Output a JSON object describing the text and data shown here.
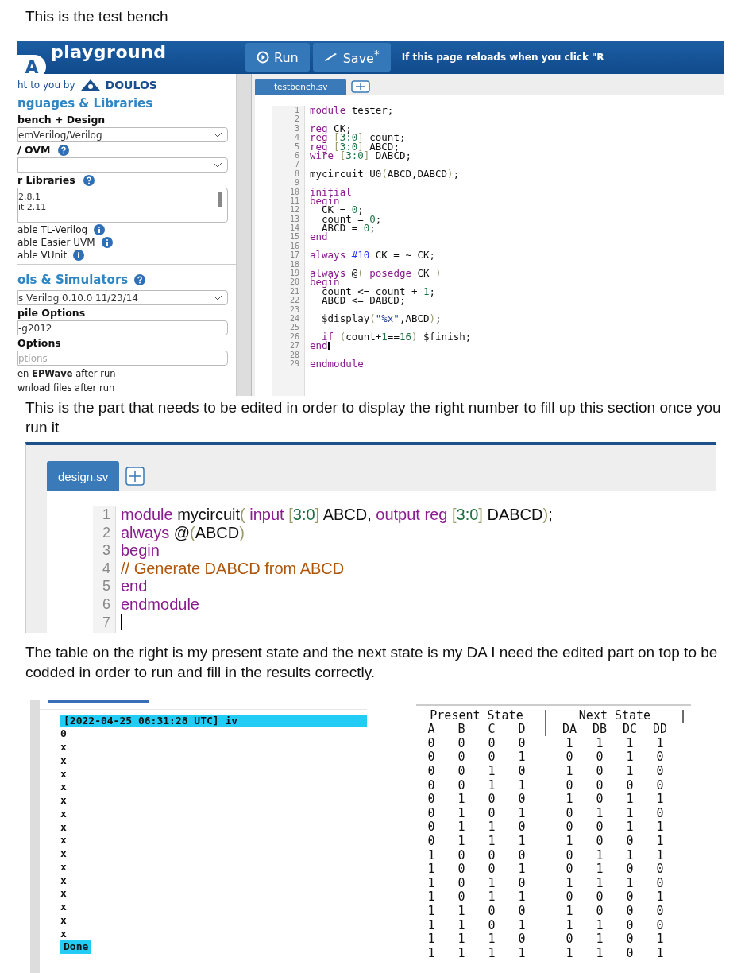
{
  "captions": [
    "This is the test bench",
    "This is the part that needs to be edited in order to display the right number to fill up this section once you run it",
    "The table on the right is my present state and the next state is my DA I need the edited part on top to be codded in order to run and fill in the results correctly."
  ],
  "playground": {
    "logo_letter": "A",
    "logo": "playground",
    "buttons": [
      {
        "kind": "run",
        "label": "Run"
      },
      {
        "kind": "save",
        "label": "Save$^{*}$"
      }
    ],
    "notice": "If this page reloads when you click \"R",
    "sidebar": [
      {
        "kind": "credit",
        "text": "ht to you by",
        "logo": "DOULOS"
      },
      {
        "kind": "heading",
        "text": "nguages & Libraries",
        "help": false
      },
      {
        "kind": "label",
        "text": "bench + Design",
        "help": false
      },
      {
        "kind": "select",
        "value": "emVerilog/Verilog"
      },
      {
        "kind": "label",
        "text": "/ OVM",
        "help": true
      },
      {
        "kind": "select"
      },
      {
        "kind": "label",
        "text": "r Libraries",
        "help": true
      },
      {
        "kind": "listbox",
        "options": [
          "2.8.1",
          "it 2.11"
        ]
      },
      {
        "kind": "option",
        "text": "able TL-Verilog"
      },
      {
        "kind": "option",
        "text": "able Easier UVM"
      },
      {
        "kind": "option",
        "text": "able VUnit"
      },
      {
        "kind": "heading",
        "text": "ols & Simulators",
        "help": true
      },
      {
        "kind": "select",
        "value": "s Verilog 0.10.0 11/23/14"
      },
      {
        "kind": "label",
        "text": "pile Options",
        "help": false
      },
      {
        "kind": "field",
        "value": "-g2012"
      },
      {
        "kind": "label",
        "text": "Options",
        "help": false
      },
      {
        "kind": "field",
        "placeholder": "ptions"
      },
      {
        "kind": "note",
        "text": "en **EPWave** after run"
      },
      {
        "kind": "note",
        "text": "wnload files after run"
      }
    ],
    "tab": "testbench.sv",
    "code": [
      {
        "number": "1",
        "tokens": [
          {
            "kind": "keyword",
            "text": "module"
          },
          {
            "kind": "plain",
            "text": " tester;"
          }
        ]
      },
      {
        "number": "2"
      },
      {
        "number": "3",
        "tokens": [
          {
            "kind": "keyword",
            "text": "reg"
          },
          {
            "kind": "plain",
            "text": " CK;"
          }
        ]
      },
      {
        "number": "4",
        "tokens": [
          {
            "kind": "keyword",
            "text": "reg"
          },
          {
            "kind": "bracket",
            "text": " ["
          },
          {
            "kind": "number",
            "text": "3:0"
          },
          {
            "kind": "bracket",
            "text": "]"
          },
          {
            "kind": "plain",
            "text": " count;"
          }
        ]
      },
      {
        "number": "5",
        "tokens": [
          {
            "kind": "keyword",
            "text": "reg"
          },
          {
            "kind": "bracket",
            "text": " ["
          },
          {
            "kind": "number",
            "text": "3:0"
          },
          {
            "kind": "bracket",
            "text": "]"
          },
          {
            "kind": "plain",
            "text": " ABCD;"
          }
        ]
      },
      {
        "number": "6",
        "tokens": [
          {
            "kind": "keyword",
            "text": "wire"
          },
          {
            "kind": "bracket",
            "text": " ["
          },
          {
            "kind": "number",
            "text": "3:0"
          },
          {
            "kind": "bracket",
            "text": "]"
          },
          {
            "kind": "plain",
            "text": " DABCD;"
          }
        ]
      },
      {
        "number": "7"
      },
      {
        "number": "8",
        "tokens": [
          {
            "kind": "plain",
            "text": "mycircuit U0"
          },
          {
            "kind": "bracket",
            "text": "("
          },
          {
            "kind": "plain",
            "text": "ABCD,DABCD"
          },
          {
            "kind": "bracket",
            "text": ")"
          },
          {
            "kind": "plain",
            "text": ";"
          }
        ]
      },
      {
        "number": "9"
      },
      {
        "number": "10",
        "tokens": [
          {
            "kind": "keyword",
            "text": "initial"
          }
        ]
      },
      {
        "number": "11",
        "tokens": [
          {
            "kind": "keyword",
            "text": "begin"
          }
        ]
      },
      {
        "number": "12",
        "tokens": [
          {
            "kind": "plain",
            "text": "  CK = "
          },
          {
            "kind": "number",
            "text": "0"
          },
          {
            "kind": "plain",
            "text": ";"
          }
        ]
      },
      {
        "number": "13",
        "tokens": [
          {
            "kind": "plain",
            "text": "  count = "
          },
          {
            "kind": "number",
            "text": "0"
          },
          {
            "kind": "plain",
            "text": ";"
          }
        ]
      },
      {
        "number": "14",
        "tokens": [
          {
            "kind": "plain",
            "text": "  ABCD = "
          },
          {
            "kind": "number",
            "text": "0"
          },
          {
            "kind": "plain",
            "text": ";"
          }
        ]
      },
      {
        "number": "15",
        "tokens": [
          {
            "kind": "keyword",
            "text": "end"
          }
        ]
      },
      {
        "number": "16"
      },
      {
        "number": "17",
        "tokens": [
          {
            "kind": "keyword",
            "text": "always"
          },
          {
            "kind": "delay",
            "text": " #10"
          },
          {
            "kind": "plain",
            "text": " CK = ~ CK;"
          }
        ]
      },
      {
        "number": "18"
      },
      {
        "number": "19",
        "tokens": [
          {
            "kind": "keyword",
            "text": "always"
          },
          {
            "kind": "plain",
            "text": " @"
          },
          {
            "kind": "bracket",
            "text": "("
          },
          {
            "kind": "keyword",
            "text": " posedge"
          },
          {
            "kind": "plain",
            "text": " CK "
          },
          {
            "kind": "bracket",
            "text": ")"
          }
        ]
      },
      {
        "number": "20",
        "tokens": [
          {
            "kind": "keyword",
            "text": "begin"
          }
        ]
      },
      {
        "number": "21",
        "tokens": [
          {
            "kind": "plain",
            "text": "  count <= count + "
          },
          {
            "kind": "number",
            "text": "1"
          },
          {
            "kind": "plain",
            "text": ";"
          }
        ]
      },
      {
        "number": "22",
        "tokens": [
          {
            "kind": "plain",
            "text": "  ABCD <= DABCD;"
          }
        ]
      },
      {
        "number": "23"
      },
      {
        "number": "24",
        "tokens": [
          {
            "kind": "plain",
            "text": "  $display"
          },
          {
            "kind": "bracket",
            "text": "("
          },
          {
            "kind": "string",
            "text": "\"%x\""
          },
          {
            "kind": "plain",
            "text": ",ABCD"
          },
          {
            "kind": "bracket",
            "text": ")"
          },
          {
            "kind": "plain",
            "text": ";"
          }
        ]
      },
      {
        "number": "25"
      },
      {
        "number": "26",
        "tokens": [
          {
            "kind": "keyword",
            "text": "  if"
          },
          {
            "kind": "bracket",
            "text": " ("
          },
          {
            "kind": "plain",
            "text": "count+"
          },
          {
            "kind": "number",
            "text": "1"
          },
          {
            "kind": "plain",
            "text": "=="
          },
          {
            "kind": "number",
            "text": "16"
          },
          {
            "kind": "bracket",
            "text": ")"
          },
          {
            "kind": "plain",
            "text": " $finish;"
          }
        ]
      },
      {
        "number": "27",
        "tokens": [
          {
            "kind": "keyword",
            "text": "end"
          }
        ],
        "cursor": true
      },
      {
        "number": "28"
      },
      {
        "number": "29",
        "tokens": [
          {
            "kind": "keyword",
            "text": "endmodule"
          }
        ]
      }
    ]
  },
  "design": {
    "tab": "design.sv",
    "code": [
      {
        "number": "1",
        "tokens": [
          {
            "kind": "keyword",
            "text": "module"
          },
          {
            "kind": "plain",
            "text": " mycircuit"
          },
          {
            "kind": "bracket",
            "text": "("
          },
          {
            "kind": "keyword",
            "text": " input"
          },
          {
            "kind": "bracket",
            "text": " ["
          },
          {
            "kind": "number",
            "text": "3:0"
          },
          {
            "kind": "bracket",
            "text": "]"
          },
          {
            "kind": "plain",
            "text": " ABCD, "
          },
          {
            "kind": "keyword",
            "text": "output reg"
          },
          {
            "kind": "bracket",
            "text": " ["
          },
          {
            "kind": "number",
            "text": "3:0"
          },
          {
            "kind": "bracket",
            "text": "]"
          },
          {
            "kind": "plain",
            "text": " DABCD"
          },
          {
            "kind": "bracket",
            "text": ")"
          },
          {
            "kind": "plain",
            "text": ";"
          }
        ]
      },
      {
        "number": "2",
        "tokens": [
          {
            "kind": "keyword",
            "text": "always"
          },
          {
            "kind": "plain",
            "text": " @"
          },
          {
            "kind": "bracket",
            "text": "("
          },
          {
            "kind": "plain",
            "text": "ABCD"
          },
          {
            "kind": "bracket",
            "text": ")"
          }
        ]
      },
      {
        "number": "3",
        "tokens": [
          {
            "kind": "keyword",
            "text": "begin"
          }
        ]
      },
      {
        "number": "4",
        "tokens": [
          {
            "kind": "comment",
            "text": "// Generate DABCD from ABCD"
          }
        ]
      },
      {
        "number": "5",
        "tokens": [
          {
            "kind": "keyword",
            "text": "end"
          }
        ]
      },
      {
        "number": "6",
        "tokens": [
          {
            "kind": "keyword",
            "text": "endmodule"
          }
        ]
      },
      {
        "number": "7",
        "cursor": true
      }
    ]
  },
  "log": [
    {
      "text": "[2022-04-25 06:31:28 UTC] iv",
      "highlight": true
    },
    {
      "text": "0",
      "highlight": false
    },
    {
      "text": "x",
      "highlight": false
    },
    {
      "text": "x",
      "highlight": false
    },
    {
      "text": "x",
      "highlight": false
    },
    {
      "text": "x",
      "highlight": false
    },
    {
      "text": "x",
      "highlight": false
    },
    {
      "text": "x",
      "highlight": false
    },
    {
      "text": "x",
      "highlight": false
    },
    {
      "text": "x",
      "highlight": false
    },
    {
      "text": "x",
      "highlight": false
    },
    {
      "text": "x",
      "highlight": false
    },
    {
      "text": "x",
      "highlight": false
    },
    {
      "text": "x",
      "highlight": false
    },
    {
      "text": "x",
      "highlight": false
    },
    {
      "text": "x",
      "highlight": false
    },
    {
      "text": "x",
      "highlight": false
    },
    {
      "text": "Done",
      "highlight": true
    }
  ],
  "state_table": {
    "groups": [
      {
        "label": "Present State",
        "separator": "|"
      },
      {
        "label": "Next State",
        "separator": "|"
      }
    ],
    "column_separator": "|",
    "columns": [
      "A",
      "B",
      "C",
      "D",
      "DA",
      "DB",
      "DC",
      "DD"
    ],
    "rows": [
      [
        "0",
        "0",
        "0",
        "0",
        "1",
        "1",
        "1",
        "1"
      ],
      [
        "0",
        "0",
        "0",
        "1",
        "0",
        "0",
        "1",
        "0"
      ],
      [
        "0",
        "0",
        "1",
        "0",
        "1",
        "0",
        "1",
        "0"
      ],
      [
        "0",
        "0",
        "1",
        "1",
        "0",
        "0",
        "0",
        "0"
      ],
      [
        "0",
        "1",
        "0",
        "0",
        "1",
        "0",
        "1",
        "1"
      ],
      [
        "0",
        "1",
        "0",
        "1",
        "0",
        "1",
        "1",
        "0"
      ],
      [
        "0",
        "1",
        "1",
        "0",
        "0",
        "0",
        "1",
        "1"
      ],
      [
        "0",
        "1",
        "1",
        "1",
        "1",
        "0",
        "0",
        "1"
      ],
      [
        "1",
        "0",
        "0",
        "0",
        "0",
        "1",
        "1",
        "1"
      ],
      [
        "1",
        "0",
        "0",
        "1",
        "0",
        "1",
        "0",
        "0"
      ],
      [
        "1",
        "0",
        "1",
        "0",
        "1",
        "1",
        "1",
        "0"
      ],
      [
        "1",
        "0",
        "1",
        "1",
        "0",
        "0",
        "0",
        "1"
      ],
      [
        "1",
        "1",
        "0",
        "0",
        "1",
        "0",
        "0",
        "0"
      ],
      [
        "1",
        "1",
        "0",
        "1",
        "1",
        "1",
        "0",
        "0"
      ],
      [
        "1",
        "1",
        "1",
        "0",
        "0",
        "1",
        "0",
        "1"
      ],
      [
        "1",
        "1",
        "1",
        "1",
        "1",
        "1",
        "0",
        "1"
      ]
    ]
  }
}
